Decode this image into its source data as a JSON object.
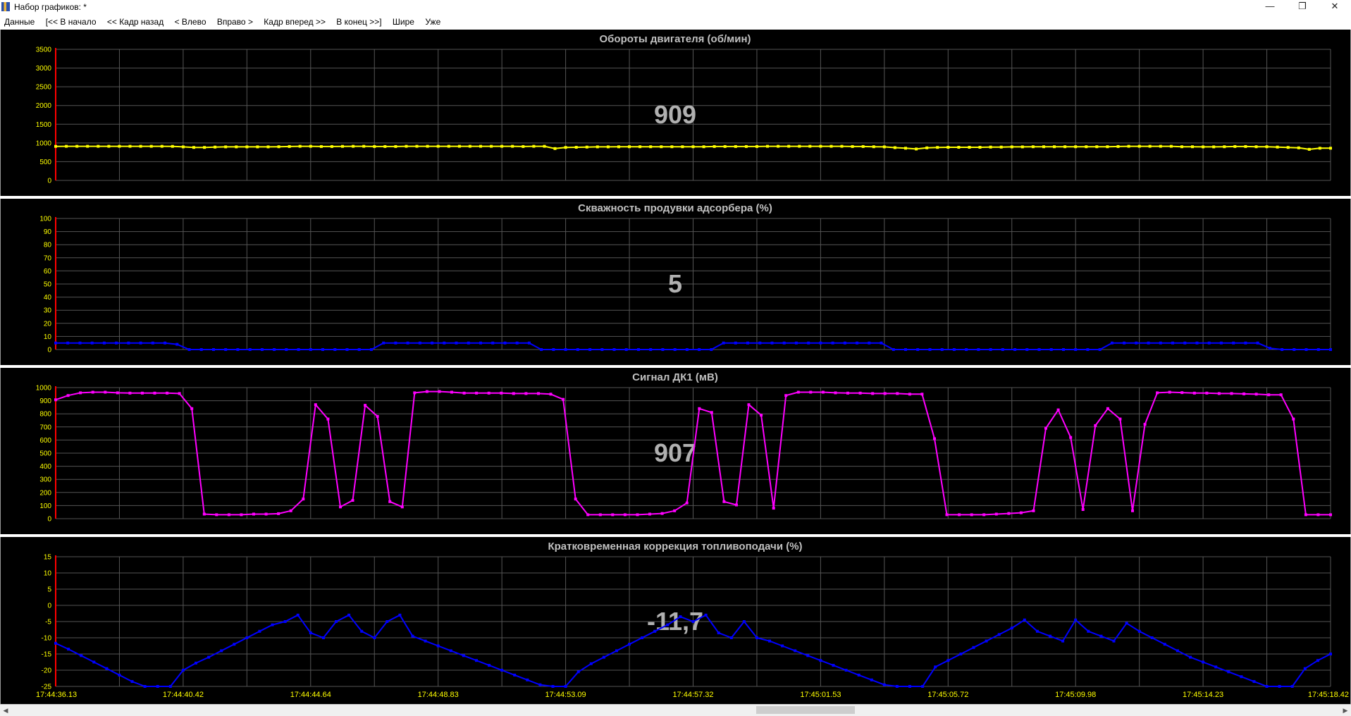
{
  "window": {
    "title": "Набор графиков: *",
    "minimize_glyph": "—",
    "restore_glyph": "❐",
    "close_glyph": "✕",
    "icon": "chart-app-icon"
  },
  "menu": [
    {
      "label": "Данные"
    },
    {
      "label": "[<< В начало"
    },
    {
      "label": "<< Кадр назад"
    },
    {
      "label": "< Влево"
    },
    {
      "label": "Вправо >"
    },
    {
      "label": "Кадр вперед >>"
    },
    {
      "label": "В конец >>]"
    },
    {
      "label": "Шире"
    },
    {
      "label": "Уже"
    }
  ],
  "scrollbar": {
    "left_glyph": "◀",
    "right_glyph": "▶"
  },
  "colors": {
    "panel_bg": "#000000",
    "grid": "#555555",
    "title_text": "#c0c0c0",
    "current_value_text": "#b0b0b0",
    "tick_text": "#ffff00",
    "y_axis_line": "#ff0000"
  },
  "chart_data": [
    {
      "type": "line",
      "title": "Обороты двигателя  (об/мин)",
      "current_value": "909",
      "color": "#ffff00",
      "ylim": [
        0,
        3500
      ],
      "yticks": [
        0,
        500,
        1000,
        1500,
        2000,
        2500,
        3000,
        3500
      ],
      "values": [
        909,
        910,
        910,
        910,
        910,
        910,
        910,
        910,
        910,
        910,
        910,
        908,
        895,
        880,
        880,
        890,
        895,
        895,
        895,
        895,
        895,
        900,
        905,
        910,
        910,
        905,
        905,
        908,
        910,
        910,
        905,
        905,
        905,
        910,
        910,
        910,
        910,
        910,
        910,
        910,
        910,
        910,
        910,
        910,
        905,
        910,
        910,
        850,
        880,
        885,
        890,
        895,
        895,
        898,
        900,
        900,
        900,
        900,
        900,
        900,
        900,
        900,
        905,
        905,
        905,
        905,
        905,
        910,
        910,
        910,
        910,
        910,
        910,
        910,
        910,
        905,
        905,
        900,
        895,
        875,
        860,
        840,
        870,
        880,
        885,
        885,
        885,
        885,
        890,
        890,
        895,
        895,
        900,
        900,
        900,
        900,
        900,
        900,
        900,
        900,
        905,
        910,
        910,
        910,
        910,
        910,
        900,
        900,
        895,
        895,
        900,
        905,
        905,
        900,
        900,
        890,
        880,
        870,
        830,
        860,
        860
      ]
    },
    {
      "type": "line",
      "title": "Скважность продувки адсорбера  (%)",
      "current_value": "5",
      "color": "#0000ff",
      "ylim": [
        0,
        100
      ],
      "yticks": [
        0,
        10,
        20,
        30,
        40,
        50,
        60,
        70,
        80,
        90,
        100
      ],
      "values": [
        5,
        5,
        5,
        5,
        5,
        5,
        5,
        5,
        5,
        5,
        4,
        0,
        0,
        0,
        0,
        0,
        0,
        0,
        0,
        0,
        0,
        0,
        0,
        0,
        0,
        0,
        0,
        5,
        5,
        5,
        5,
        5,
        5,
        5,
        5,
        5,
        5,
        5,
        5,
        5,
        0,
        0,
        0,
        0,
        0,
        0,
        0,
        0,
        0,
        0,
        0,
        0,
        0,
        0,
        0,
        5,
        5,
        5,
        5,
        5,
        5,
        5,
        5,
        5,
        5,
        5,
        5,
        5,
        5,
        0,
        0,
        0,
        0,
        0,
        0,
        0,
        0,
        0,
        0,
        0,
        0,
        0,
        0,
        0,
        0,
        0,
        0,
        5,
        5,
        5,
        5,
        5,
        5,
        5,
        5,
        5,
        5,
        5,
        5,
        5,
        1,
        0,
        0,
        0,
        0,
        0
      ]
    },
    {
      "type": "line",
      "title": "Сигнал ДК1  (мВ)",
      "current_value": "907",
      "color": "#ff00ff",
      "ylim": [
        0,
        1000
      ],
      "yticks": [
        0,
        100,
        200,
        300,
        400,
        500,
        600,
        700,
        800,
        900,
        1000
      ],
      "values": [
        907,
        940,
        960,
        965,
        965,
        960,
        958,
        958,
        958,
        958,
        955,
        840,
        35,
        30,
        30,
        30,
        35,
        35,
        38,
        60,
        150,
        870,
        760,
        90,
        140,
        865,
        780,
        130,
        90,
        960,
        970,
        970,
        965,
        958,
        958,
        958,
        958,
        955,
        955,
        955,
        950,
        910,
        150,
        30,
        30,
        30,
        30,
        30,
        35,
        40,
        60,
        120,
        840,
        810,
        130,
        105,
        870,
        790,
        80,
        940,
        965,
        965,
        965,
        960,
        958,
        958,
        955,
        955,
        955,
        950,
        950,
        610,
        30,
        30,
        30,
        30,
        35,
        40,
        45,
        60,
        690,
        830,
        620,
        70,
        710,
        840,
        760,
        60,
        720,
        960,
        965,
        962,
        958,
        958,
        955,
        955,
        952,
        950,
        945,
        945,
        760,
        30,
        30,
        30
      ]
    },
    {
      "type": "line",
      "title": "Кратковременная коррекция топливоподачи  (%)",
      "current_value": "-11,7",
      "color": "#0000ff",
      "ylim": [
        -25,
        15
      ],
      "yticks": [
        -25,
        -20,
        -15,
        -10,
        -5,
        0,
        5,
        10,
        15
      ],
      "values": [
        -11.7,
        -13.5,
        -15.5,
        -17.5,
        -19.5,
        -21.5,
        -23.5,
        -25.0,
        -25.0,
        -25.0,
        -20.0,
        -17.8,
        -16.0,
        -14.0,
        -12.0,
        -10.0,
        -8.0,
        -6.0,
        -5.0,
        -3.0,
        -8.5,
        -10.0,
        -5.0,
        -3.0,
        -8.0,
        -10.0,
        -5.0,
        -3.0,
        -9.5,
        -11.0,
        -12.5,
        -14.0,
        -15.5,
        -17.0,
        -18.5,
        -20.0,
        -21.5,
        -23.0,
        -24.5,
        -25.0,
        -25.0,
        -20.5,
        -18.0,
        -16.0,
        -14.0,
        -12.0,
        -10.0,
        -8.0,
        -6.0,
        -3.5,
        -5.0,
        -3.0,
        -8.5,
        -10.0,
        -5.0,
        -10.0,
        -11.0,
        -12.5,
        -14.0,
        -15.5,
        -17.0,
        -18.5,
        -20.0,
        -21.5,
        -23.0,
        -24.5,
        -25.0,
        -25.0,
        -25.0,
        -19.0,
        -17.0,
        -15.0,
        -13.0,
        -11.0,
        -9.0,
        -7.0,
        -4.5,
        -8.0,
        -9.5,
        -11.0,
        -4.5,
        -8.0,
        -9.5,
        -11.0,
        -5.5,
        -8.0,
        -10.0,
        -12.0,
        -14.0,
        -16.0,
        -17.5,
        -19.0,
        -20.5,
        -22.0,
        -23.5,
        -25.0,
        -25.0,
        -25.0,
        -19.5,
        -17.0,
        -15.0
      ]
    }
  ],
  "x_axis": {
    "labels": [
      "17:44:36.13",
      "17:44:40.42",
      "17:44:44.64",
      "17:44:48.83",
      "17:44:53.09",
      "17:44:57.32",
      "17:45:01.53",
      "17:45:05.72",
      "17:45:09.98",
      "17:45:14.23",
      "17:45:18.42"
    ]
  }
}
